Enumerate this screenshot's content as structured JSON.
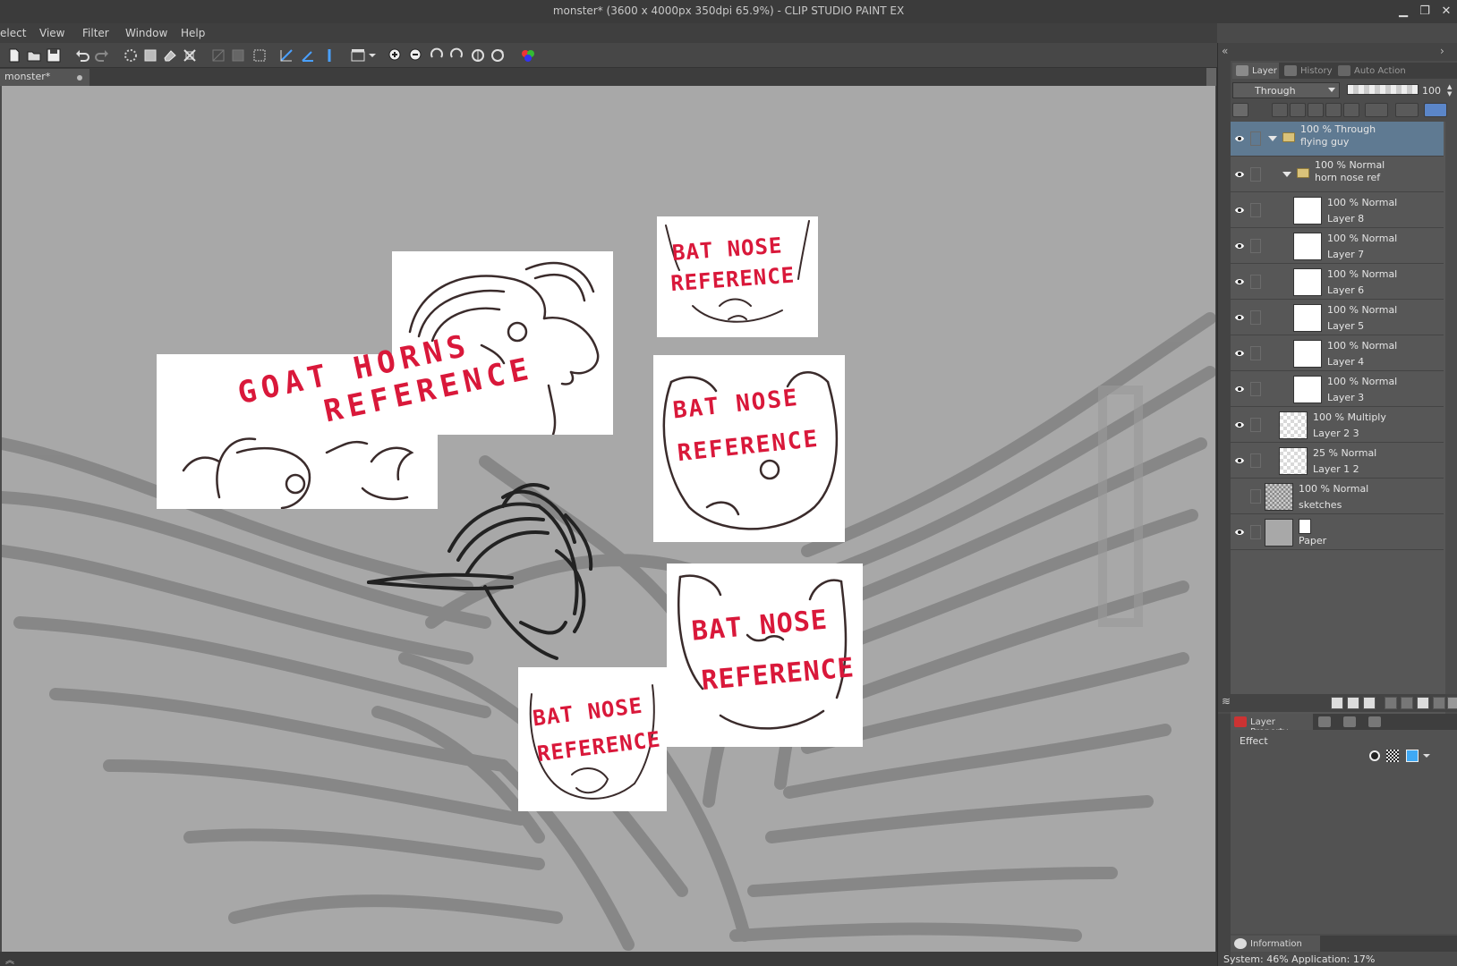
{
  "titlebar": {
    "title": "monster* (3600 x 4000px 350dpi 65.9%)  - CLIP STUDIO PAINT EX",
    "min": "▁",
    "restore": "❐",
    "close": "✕"
  },
  "menu": {
    "items": [
      "elect",
      "View",
      "Filter",
      "Window",
      "Help"
    ]
  },
  "document_tab": {
    "label": "monster*"
  },
  "canvas": {
    "background_color": "#a8a8a8",
    "references": [
      {
        "label_1": "GOAT HORNS",
        "label_2": "REFERENCE",
        "label_color": "#d9183a"
      },
      {
        "label_1": "BAT NOSE",
        "label_2": "REFERENCE",
        "label_color": "#d9183a"
      },
      {
        "label_1": "BAT NOSE",
        "label_2": "REFERENCE",
        "label_color": "#d9183a"
      },
      {
        "label_1": "BAT NOSE",
        "label_2": "REFERENCE",
        "label_color": "#d9183a"
      },
      {
        "label_1": "BAT NOSE",
        "label_2": "REFERENCE",
        "label_color": "#d9183a"
      }
    ]
  },
  "layer_panel": {
    "tabs": [
      {
        "label": "Layer",
        "icon": "layer-icon"
      },
      {
        "label": "History",
        "icon": "history-icon"
      },
      {
        "label": "Auto Action",
        "icon": "auto-action-icon"
      }
    ],
    "blend_mode": "Through",
    "opacity": "100",
    "layers": [
      {
        "line1": "100 % Through",
        "line2": "flying guy",
        "kind": "folder",
        "indent": 0,
        "expanded": true,
        "selected": true,
        "visible": true
      },
      {
        "line1": "100 % Normal",
        "line2": "horn nose ref",
        "kind": "folder",
        "indent": 1,
        "expanded": true,
        "selected": false,
        "visible": true
      },
      {
        "line1": "100 % Normal",
        "line2": "Layer 8",
        "kind": "white",
        "indent": 2,
        "selected": false,
        "visible": true
      },
      {
        "line1": "100 % Normal",
        "line2": "Layer 7",
        "kind": "white",
        "indent": 2,
        "selected": false,
        "visible": true
      },
      {
        "line1": "100 % Normal",
        "line2": "Layer 6",
        "kind": "white",
        "indent": 2,
        "selected": false,
        "visible": true
      },
      {
        "line1": "100 % Normal",
        "line2": "Layer 5",
        "kind": "white",
        "indent": 2,
        "selected": false,
        "visible": true
      },
      {
        "line1": "100 % Normal",
        "line2": "Layer 4",
        "kind": "white",
        "indent": 2,
        "selected": false,
        "visible": true
      },
      {
        "line1": "100 % Normal",
        "line2": "Layer 3",
        "kind": "white",
        "indent": 2,
        "selected": false,
        "visible": true
      },
      {
        "line1": "100 % Multiply",
        "line2": "Layer 2 3",
        "kind": "checker",
        "indent": 1,
        "selected": false,
        "visible": true
      },
      {
        "line1": "25 % Normal",
        "line2": "Layer 1 2",
        "kind": "checker",
        "indent": 1,
        "selected": false,
        "visible": true
      },
      {
        "line1": "100 % Normal",
        "line2": "sketches",
        "kind": "sketch",
        "indent": 0,
        "selected": false,
        "visible": false
      },
      {
        "line1": "",
        "line2": "Paper",
        "kind": "paper",
        "indent": 0,
        "selected": false,
        "visible": true
      }
    ]
  },
  "property_panel": {
    "tabs": [
      {
        "label": "Layer Property",
        "icon": "layer-property-icon"
      }
    ],
    "effect_label": "Effect"
  },
  "info_panel": {
    "tab": "Information",
    "system_text": "System: 46%  Application: 17%"
  },
  "colors": {
    "accent_selected": "#5f7a92",
    "canvas_gray": "#a8a8a8",
    "reference_text": "#d9183a"
  }
}
